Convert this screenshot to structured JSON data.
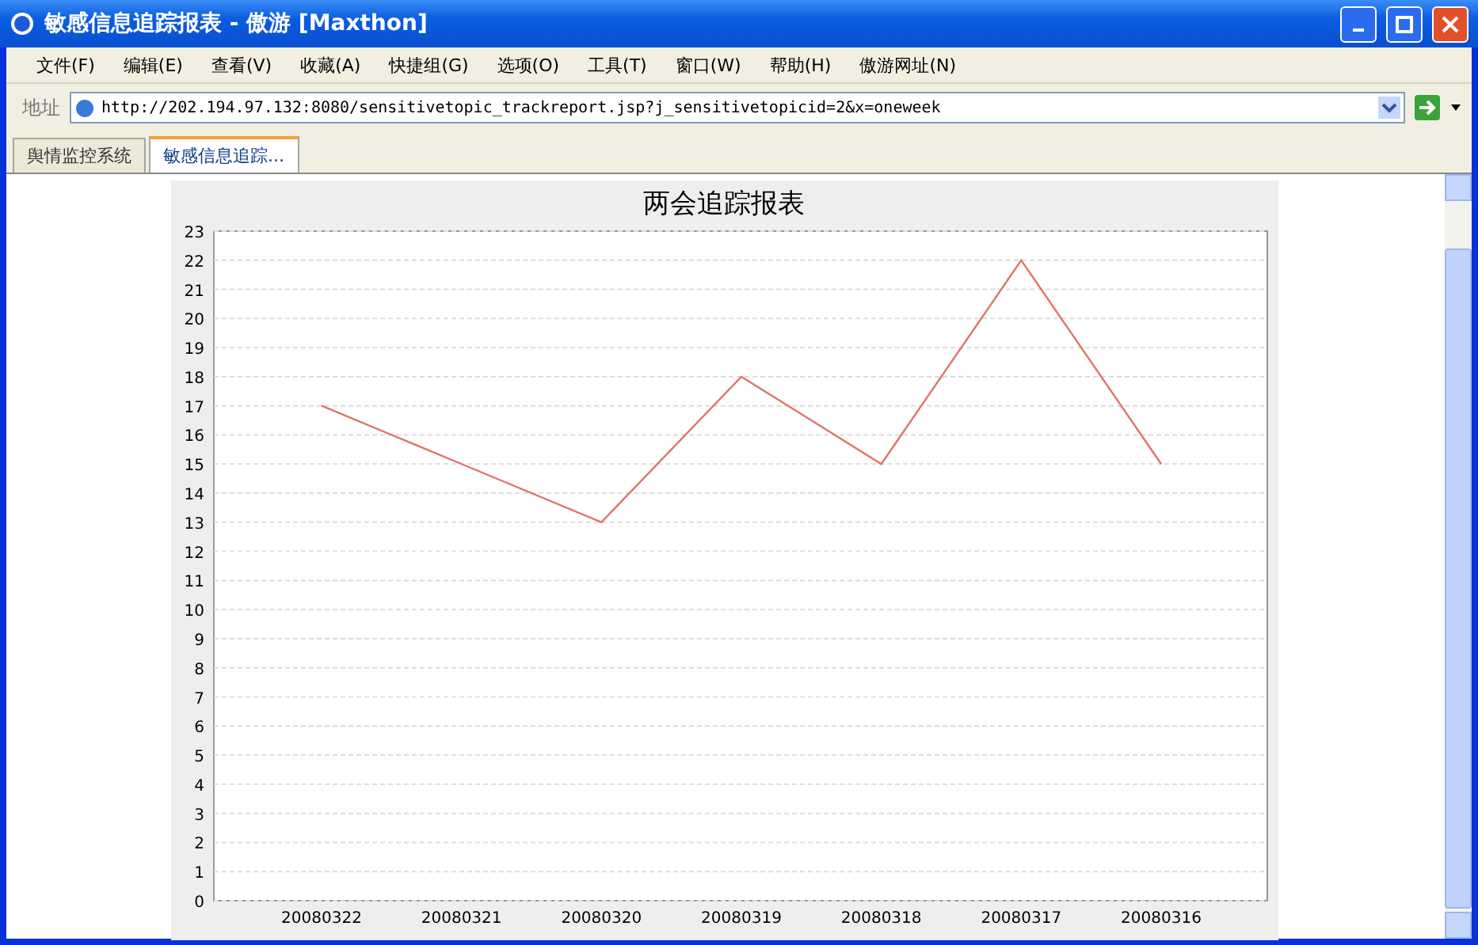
{
  "window": {
    "title": "敏感信息追踪报表 - 傲游 [Maxthon]"
  },
  "menu": [
    "文件(F)",
    "编辑(E)",
    "查看(V)",
    "收藏(A)",
    "快捷组(G)",
    "选项(O)",
    "工具(T)",
    "窗口(W)",
    "帮助(H)",
    "傲游网址(N)"
  ],
  "address": {
    "label": "地址",
    "value": "http://202.194.97.132:8080/sensitivetopic_trackreport.jsp?j_sensitivetopicid=2&x=oneweek"
  },
  "tabs": [
    {
      "label": "舆情监控系统",
      "selected": false
    },
    {
      "label": "敏感信息追踪...",
      "selected": true
    }
  ],
  "chart_data": {
    "type": "line",
    "title": "两会追踪报表",
    "categories": [
      "20080322",
      "20080321",
      "20080320",
      "20080319",
      "20080318",
      "20080317",
      "20080316"
    ],
    "series": [
      {
        "color": "#e0736a",
        "values": [
          17,
          15,
          13,
          18,
          15,
          22,
          15
        ]
      }
    ],
    "grid": true,
    "ylim": [
      0,
      23
    ],
    "yticks": [
      0,
      1,
      2,
      3,
      4,
      5,
      6,
      7,
      8,
      9,
      10,
      11,
      12,
      13,
      14,
      15,
      16,
      17,
      18,
      19,
      20,
      21,
      22,
      23
    ]
  }
}
